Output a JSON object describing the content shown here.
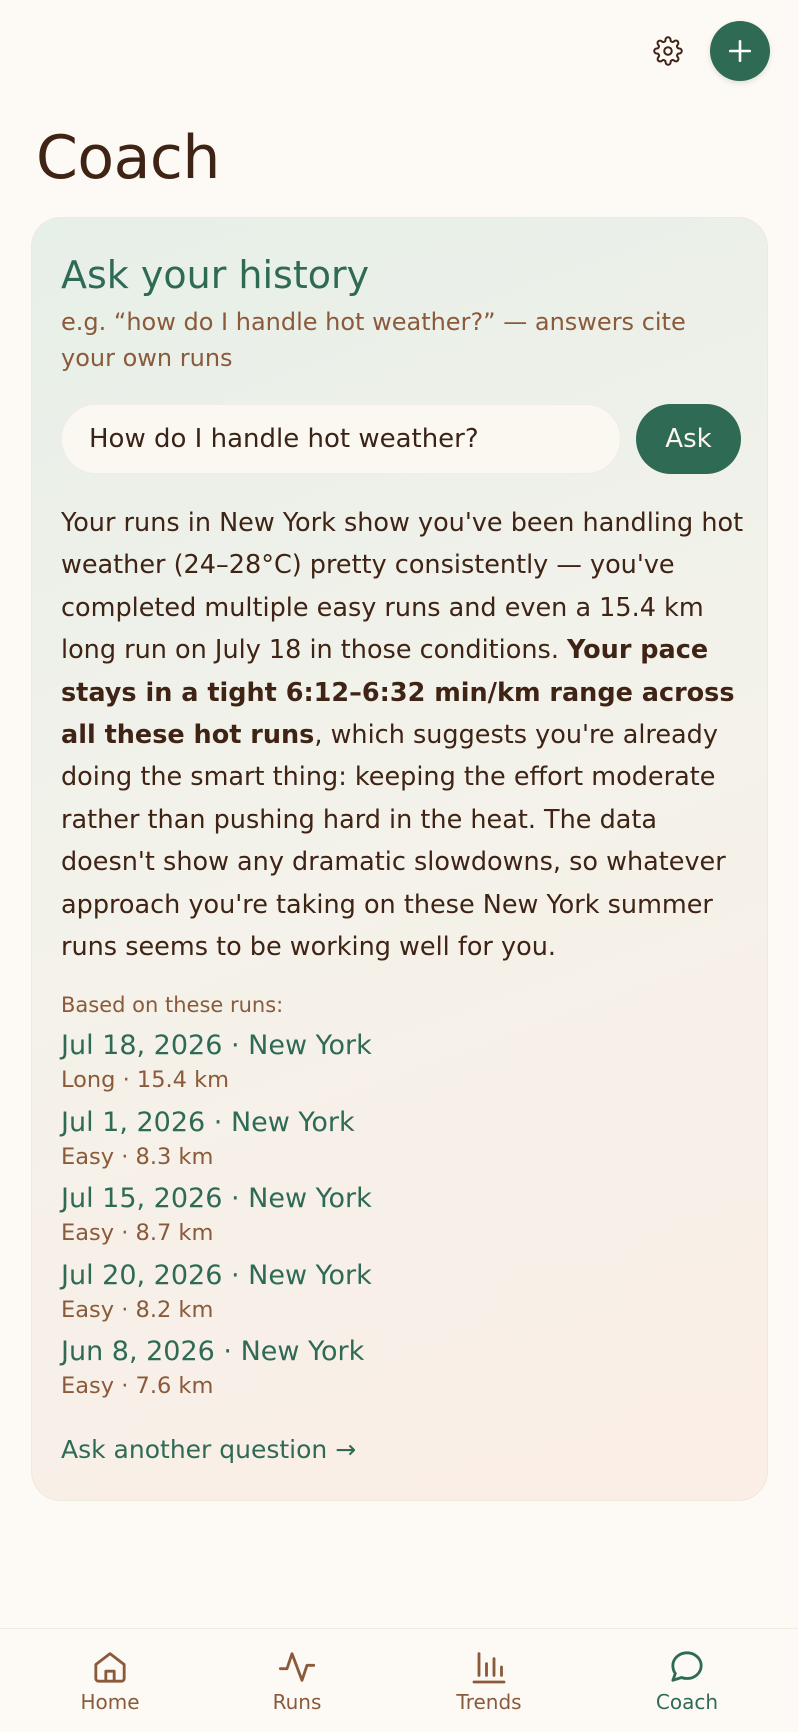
{
  "header": {
    "settings_icon": "gear-icon",
    "add_icon": "plus-icon"
  },
  "page": {
    "title": "Coach"
  },
  "coach_card": {
    "title": "Ask your history",
    "subtitle": "e.g. “how do I handle hot weather?” — answers cite your own runs",
    "input_value": "How do I handle hot weather?",
    "ask_label": "Ask",
    "answer_part1": "Your runs in New York show you've been handling hot weather (24–28°C) pretty consistently — you've completed multiple easy runs and even a 15.4 km long run on July 18 in those conditions. ",
    "answer_bold": "Your pace stays in a tight 6:12–6:32 min/km range across all these hot runs",
    "answer_part2": ", which suggests you're already doing the smart thing: keeping the effort moderate rather than pushing hard in the heat. The data doesn't show any dramatic slowdowns, so whatever approach you're taking on these New York summer runs seems to be working well for you.",
    "based_on_label": "Based on these runs:",
    "runs": [
      {
        "title": "Jul 18, 2026 · New York",
        "meta": "Long · 15.4 km"
      },
      {
        "title": "Jul 1, 2026 · New York",
        "meta": "Easy · 8.3 km"
      },
      {
        "title": "Jul 15, 2026 · New York",
        "meta": "Easy · 8.7 km"
      },
      {
        "title": "Jul 20, 2026 · New York",
        "meta": "Easy · 8.2 km"
      },
      {
        "title": "Jun 8, 2026 · New York",
        "meta": "Easy · 7.6 km"
      }
    ],
    "ask_another_label": "Ask another question →"
  },
  "nav": {
    "items": [
      {
        "label": "Home",
        "icon": "home-icon"
      },
      {
        "label": "Runs",
        "icon": "activity-icon"
      },
      {
        "label": "Trends",
        "icon": "bar-chart-icon"
      },
      {
        "label": "Coach",
        "icon": "chat-bubble-icon",
        "active": true
      }
    ]
  },
  "colors": {
    "accent": "#2f6a55",
    "brown_text": "#3f2315",
    "muted_brown": "#8a5a3a",
    "background": "#fdfaf5"
  }
}
